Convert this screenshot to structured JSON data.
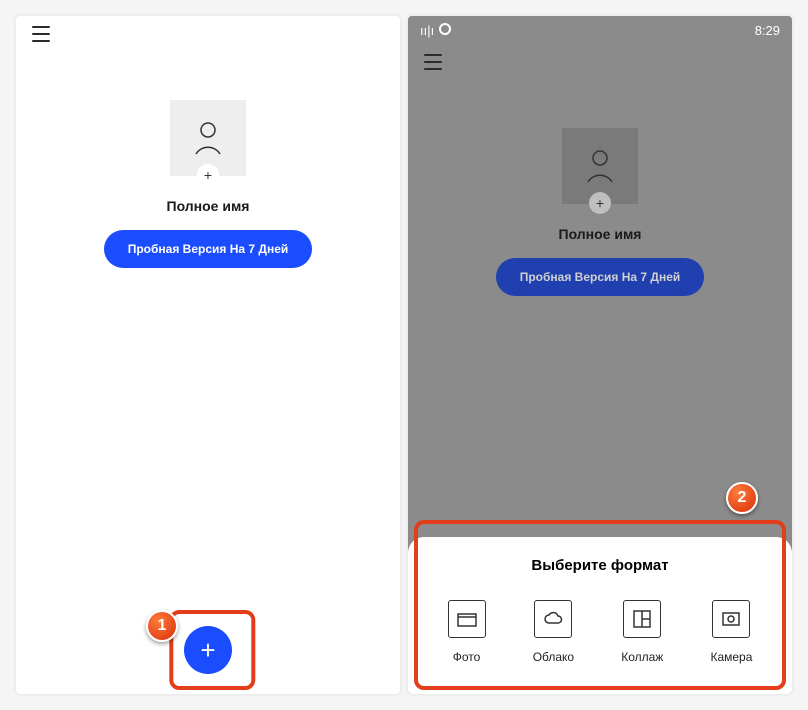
{
  "status": {
    "time": "8:29"
  },
  "profile": {
    "name_label": "Полное имя",
    "trial_button": "Пробная Версия На 7 Дней"
  },
  "bottom_sheet": {
    "title": "Выберите формат",
    "options": [
      {
        "label": "Фото"
      },
      {
        "label": "Облако"
      },
      {
        "label": "Коллаж"
      },
      {
        "label": "Камера"
      }
    ]
  },
  "annotations": {
    "marker1": "1",
    "marker2": "2"
  }
}
